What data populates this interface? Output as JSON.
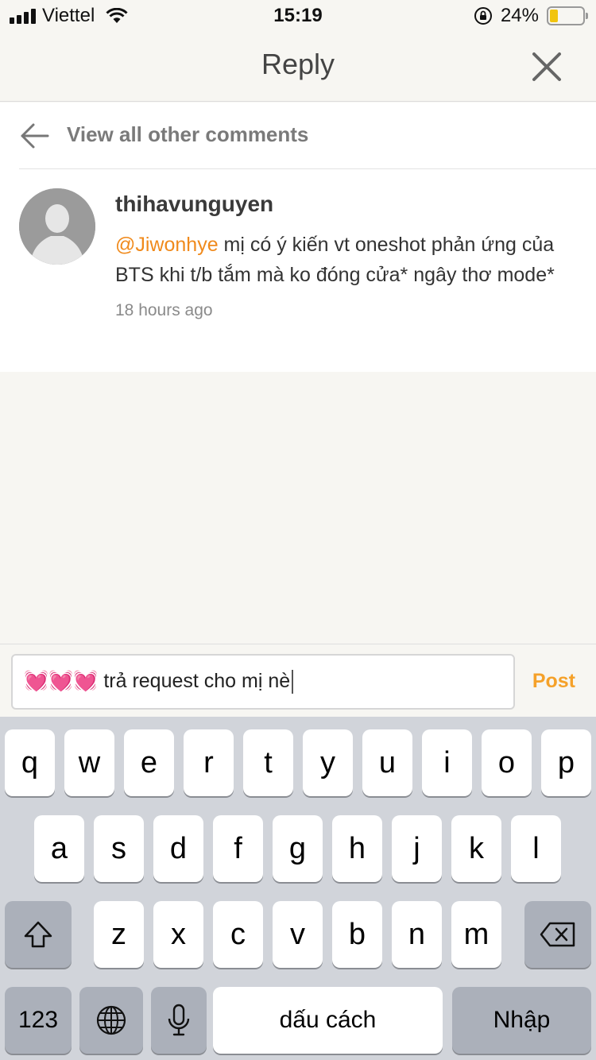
{
  "status_bar": {
    "carrier": "Viettel",
    "time": "15:19",
    "battery_percent": "24%",
    "battery_level": 0.24
  },
  "header": {
    "title": "Reply"
  },
  "back": {
    "label": "View all other comments"
  },
  "comment": {
    "username": "thihavunguyen",
    "mention": "@Jiwonhye",
    "text": " mị có ý kiến vt oneshot phản ứng của BTS khi t/b tắm mà ko đóng cửa* ngây thơ mode*",
    "time_ago": "18 hours ago"
  },
  "composer": {
    "value": "💓💓💓 trả request cho mị nè",
    "post_label": "Post"
  },
  "keyboard": {
    "row1": [
      "q",
      "w",
      "e",
      "r",
      "t",
      "y",
      "u",
      "i",
      "o",
      "p"
    ],
    "row2": [
      "a",
      "s",
      "d",
      "f",
      "g",
      "h",
      "j",
      "k",
      "l"
    ],
    "row3": [
      "z",
      "x",
      "c",
      "v",
      "b",
      "n",
      "m"
    ],
    "numbers_label": "123",
    "space_label": "dấu cách",
    "return_label": "Nhập"
  },
  "colors": {
    "accent": "#f08a1c",
    "post": "#f5a12a",
    "background": "#f7f6f2"
  }
}
